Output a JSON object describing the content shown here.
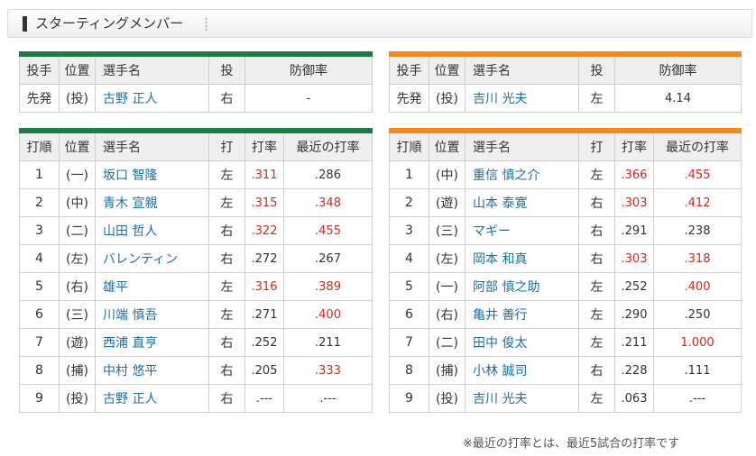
{
  "header": {
    "title": "スターティングメンバー"
  },
  "pitchers": {
    "headers": [
      "投手",
      "位置",
      "選手名",
      "投",
      "防御率"
    ],
    "left": {
      "order": "先発",
      "pos": "(投)",
      "name": "古野 正人",
      "hand": "右",
      "era": "-"
    },
    "right": {
      "order": "先発",
      "pos": "(投)",
      "name": "吉川 光夫",
      "hand": "左",
      "era": "4.14"
    }
  },
  "lineup": {
    "headers": [
      "打順",
      "位置",
      "選手名",
      "打",
      "打率",
      "最近の打率"
    ],
    "left": [
      {
        "order": "1",
        "pos": "(一)",
        "name": "坂口 智隆",
        "hand": "左",
        "avg": ".311",
        "recent": ".286"
      },
      {
        "order": "2",
        "pos": "(中)",
        "name": "青木 宣親",
        "hand": "左",
        "avg": ".315",
        "recent": ".348"
      },
      {
        "order": "3",
        "pos": "(二)",
        "name": "山田 哲人",
        "hand": "右",
        "avg": ".322",
        "recent": ".455"
      },
      {
        "order": "4",
        "pos": "(左)",
        "name": "バレンティン",
        "hand": "右",
        "avg": ".272",
        "recent": ".267"
      },
      {
        "order": "5",
        "pos": "(右)",
        "name": "雄平",
        "hand": "左",
        "avg": ".316",
        "recent": ".389"
      },
      {
        "order": "6",
        "pos": "(三)",
        "name": "川端 慎吾",
        "hand": "左",
        "avg": ".271",
        "recent": ".400"
      },
      {
        "order": "7",
        "pos": "(遊)",
        "name": "西浦 直亨",
        "hand": "右",
        "avg": ".252",
        "recent": ".211"
      },
      {
        "order": "8",
        "pos": "(捕)",
        "name": "中村 悠平",
        "hand": "右",
        "avg": ".205",
        "recent": ".333"
      },
      {
        "order": "9",
        "pos": "(投)",
        "name": "古野 正人",
        "hand": "右",
        "avg": ".---",
        "recent": ".---"
      }
    ],
    "right": [
      {
        "order": "1",
        "pos": "(中)",
        "name": "重信 慎之介",
        "hand": "左",
        "avg": ".366",
        "recent": ".455"
      },
      {
        "order": "2",
        "pos": "(遊)",
        "name": "山本 泰寛",
        "hand": "右",
        "avg": ".303",
        "recent": ".412"
      },
      {
        "order": "3",
        "pos": "(三)",
        "name": "マギー",
        "hand": "右",
        "avg": ".291",
        "recent": ".238"
      },
      {
        "order": "4",
        "pos": "(左)",
        "name": "岡本 和真",
        "hand": "右",
        "avg": ".303",
        "recent": ".318"
      },
      {
        "order": "5",
        "pos": "(一)",
        "name": "阿部 慎之助",
        "hand": "左",
        "avg": ".252",
        "recent": ".400"
      },
      {
        "order": "6",
        "pos": "(右)",
        "name": "亀井 善行",
        "hand": "左",
        "avg": ".290",
        "recent": ".250"
      },
      {
        "order": "7",
        "pos": "(二)",
        "name": "田中 俊太",
        "hand": "左",
        "avg": ".211",
        "recent": "1.000"
      },
      {
        "order": "8",
        "pos": "(捕)",
        "name": "小林 誠司",
        "hand": "右",
        "avg": ".228",
        "recent": ".111"
      },
      {
        "order": "9",
        "pos": "(投)",
        "name": "吉川 光夫",
        "hand": "左",
        "avg": ".063",
        "recent": ".---"
      }
    ]
  },
  "colors": {
    "highlight": "#d9261c",
    "left_team": "#1a7d48",
    "right_team": "#f28a1b"
  },
  "highlight_threshold": 0.3,
  "footnote": "※最近の打率とは、最近5試合の打率です"
}
